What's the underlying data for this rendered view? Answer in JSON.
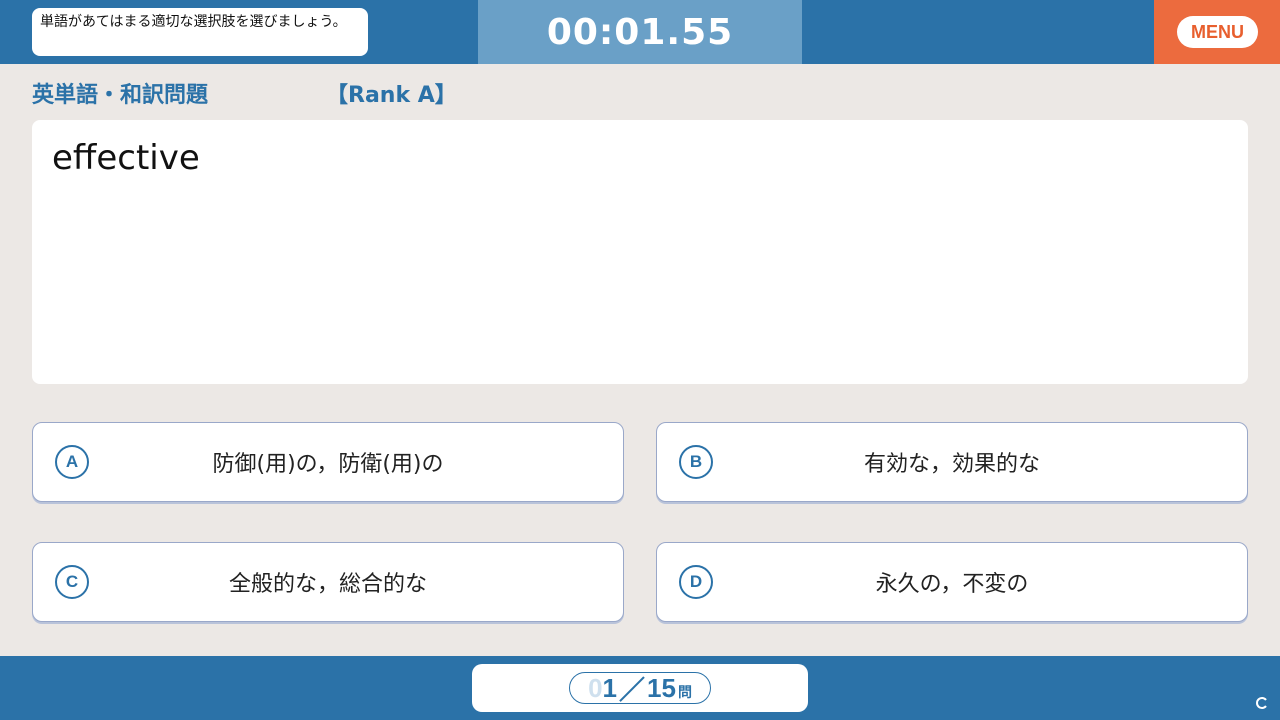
{
  "header": {
    "instruction": "単語があてはまる適切な選択肢を選びましょう。",
    "timer": "00:01.55",
    "menu_label": "MENU"
  },
  "quiz": {
    "category": "英単語・和訳問題",
    "rank": "【Rank A】",
    "word": "effective"
  },
  "choices": [
    {
      "letter": "A",
      "text": "防御(用)の，防衛(用)の"
    },
    {
      "letter": "B",
      "text": "有効な，効果的な"
    },
    {
      "letter": "C",
      "text": "全般的な，総合的な"
    },
    {
      "letter": "D",
      "text": "永久の，不変の"
    }
  ],
  "footer": {
    "progress_lead": "0",
    "progress_current": "1",
    "progress_sep": "／",
    "progress_total": "15",
    "progress_unit": "問"
  },
  "icons": {
    "reload": "reload-icon"
  },
  "colors": {
    "primary": "#2b72a8",
    "accent": "#ec6b3e",
    "timer_bg": "#6aa0c7",
    "background": "#ece8e5"
  }
}
